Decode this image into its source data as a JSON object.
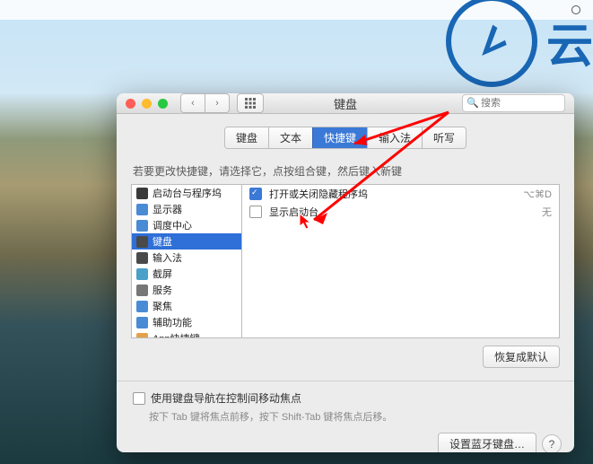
{
  "watermark_text": "云",
  "window": {
    "title": "键盘",
    "search_placeholder": "搜索"
  },
  "tabs": [
    "键盘",
    "文本",
    "快捷键",
    "输入法",
    "听写"
  ],
  "active_tab_index": 2,
  "hint": "若要更改快捷键，请选择它，点按组合键，然后键入新键",
  "sidebar": [
    {
      "label": "启动台与程序坞",
      "icon": "ic-launch"
    },
    {
      "label": "显示器",
      "icon": "ic-display"
    },
    {
      "label": "调度中心",
      "icon": "ic-mission"
    },
    {
      "label": "键盘",
      "icon": "ic-keyboard"
    },
    {
      "label": "输入法",
      "icon": "ic-input"
    },
    {
      "label": "截屏",
      "icon": "ic-screenshot"
    },
    {
      "label": "服务",
      "icon": "ic-services"
    },
    {
      "label": "聚焦",
      "icon": "ic-spotlight"
    },
    {
      "label": "辅助功能",
      "icon": "ic-access"
    },
    {
      "label": "App快捷键",
      "icon": "ic-app"
    }
  ],
  "sidebar_active_index": 3,
  "shortcuts": [
    {
      "checked": true,
      "label": "打开或关闭隐藏程序坞",
      "shortcut": "⌥⌘D"
    },
    {
      "checked": false,
      "label": "显示启动台",
      "shortcut": "无"
    }
  ],
  "restore_label": "恢复成默认",
  "bottom_checkbox_label": "使用键盘导航在控制间移动焦点",
  "bottom_hint": "按下 Tab 键将焦点前移，按下 Shift-Tab 键将焦点后移。",
  "bluetooth_label": "设置蓝牙键盘…"
}
